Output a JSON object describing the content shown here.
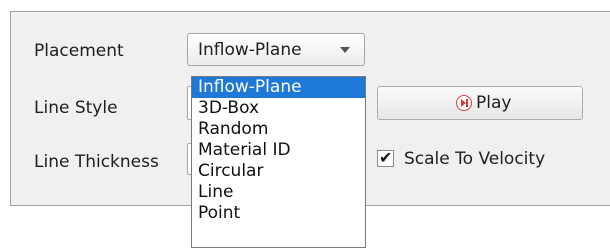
{
  "placement": {
    "label": "Placement",
    "value": "Inflow-Plane",
    "options": [
      "Inflow-Plane",
      "3D-Box",
      "Random",
      "Material ID",
      "Circular",
      "Line",
      "Point"
    ],
    "selected_index": 0
  },
  "line_style": {
    "label": "Line Style"
  },
  "line_thickness": {
    "label": "Line Thickness"
  },
  "play_button": {
    "label": "Play",
    "icon": "play-pause-icon"
  },
  "scale_to_velocity": {
    "label": "Scale To Velocity",
    "checked": true
  },
  "colors": {
    "selection": "#1e78d7",
    "play_icon": "#d43a3a",
    "panel": "#f0f0f0"
  }
}
